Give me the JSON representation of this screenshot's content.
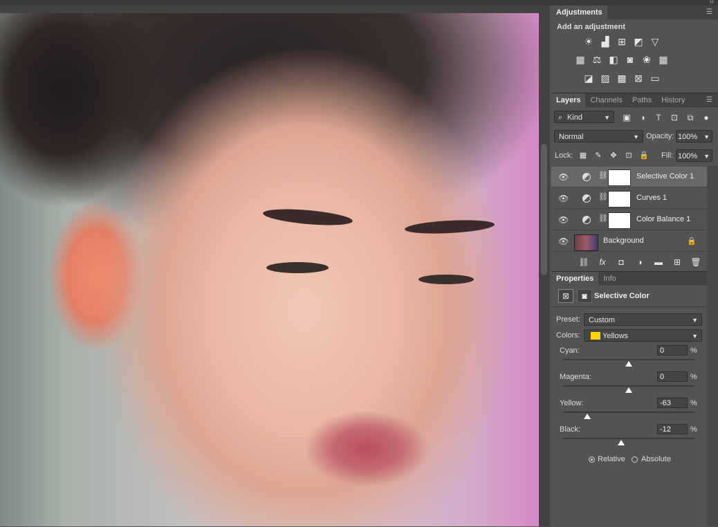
{
  "adjustments": {
    "tab": "Adjustments",
    "heading": "Add an adjustment",
    "icon_rows": [
      [
        "brightness-contrast-icon",
        "levels-icon",
        "curves-icon",
        "exposure-icon",
        "vibrance-icon"
      ],
      [
        "hue-saturation-icon",
        "color-balance-icon",
        "black-white-icon",
        "photo-filter-icon",
        "channel-mixer-icon",
        "color-lookup-icon"
      ],
      [
        "invert-icon",
        "posterize-icon",
        "threshold-icon",
        "selective-color-icon",
        "gradient-map-icon"
      ]
    ]
  },
  "layers_panel": {
    "tabs": [
      "Layers",
      "Channels",
      "Paths",
      "History"
    ],
    "kind": "Kind",
    "blend_mode": "Normal",
    "opacity_label": "Opacity:",
    "opacity": "100%",
    "lock_label": "Lock:",
    "fill_label": "Fill:",
    "fill": "100%",
    "layers": [
      {
        "name": "Selective Color 1",
        "selected": true
      },
      {
        "name": "Curves 1",
        "selected": false
      },
      {
        "name": "Color Balance 1",
        "selected": false
      },
      {
        "name": "Background",
        "selected": false
      }
    ]
  },
  "properties": {
    "tabs": [
      "Properties",
      "Info"
    ],
    "title": "Selective Color",
    "preset_label": "Preset:",
    "preset": "Custom",
    "colors_label": "Colors:",
    "colors": "Yellows",
    "colors_swatch": "#ffd400",
    "sliders": [
      {
        "label": "Cyan:",
        "value": "0",
        "fraction": 0.5
      },
      {
        "label": "Magenta:",
        "value": "0",
        "fraction": 0.5
      },
      {
        "label": "Yellow:",
        "value": "-63",
        "fraction": 0.185
      },
      {
        "label": "Black:",
        "value": "-12",
        "fraction": 0.44
      }
    ],
    "percent": "%",
    "method_relative": "Relative",
    "method_absolute": "Absolute",
    "method_selected": "Relative"
  }
}
